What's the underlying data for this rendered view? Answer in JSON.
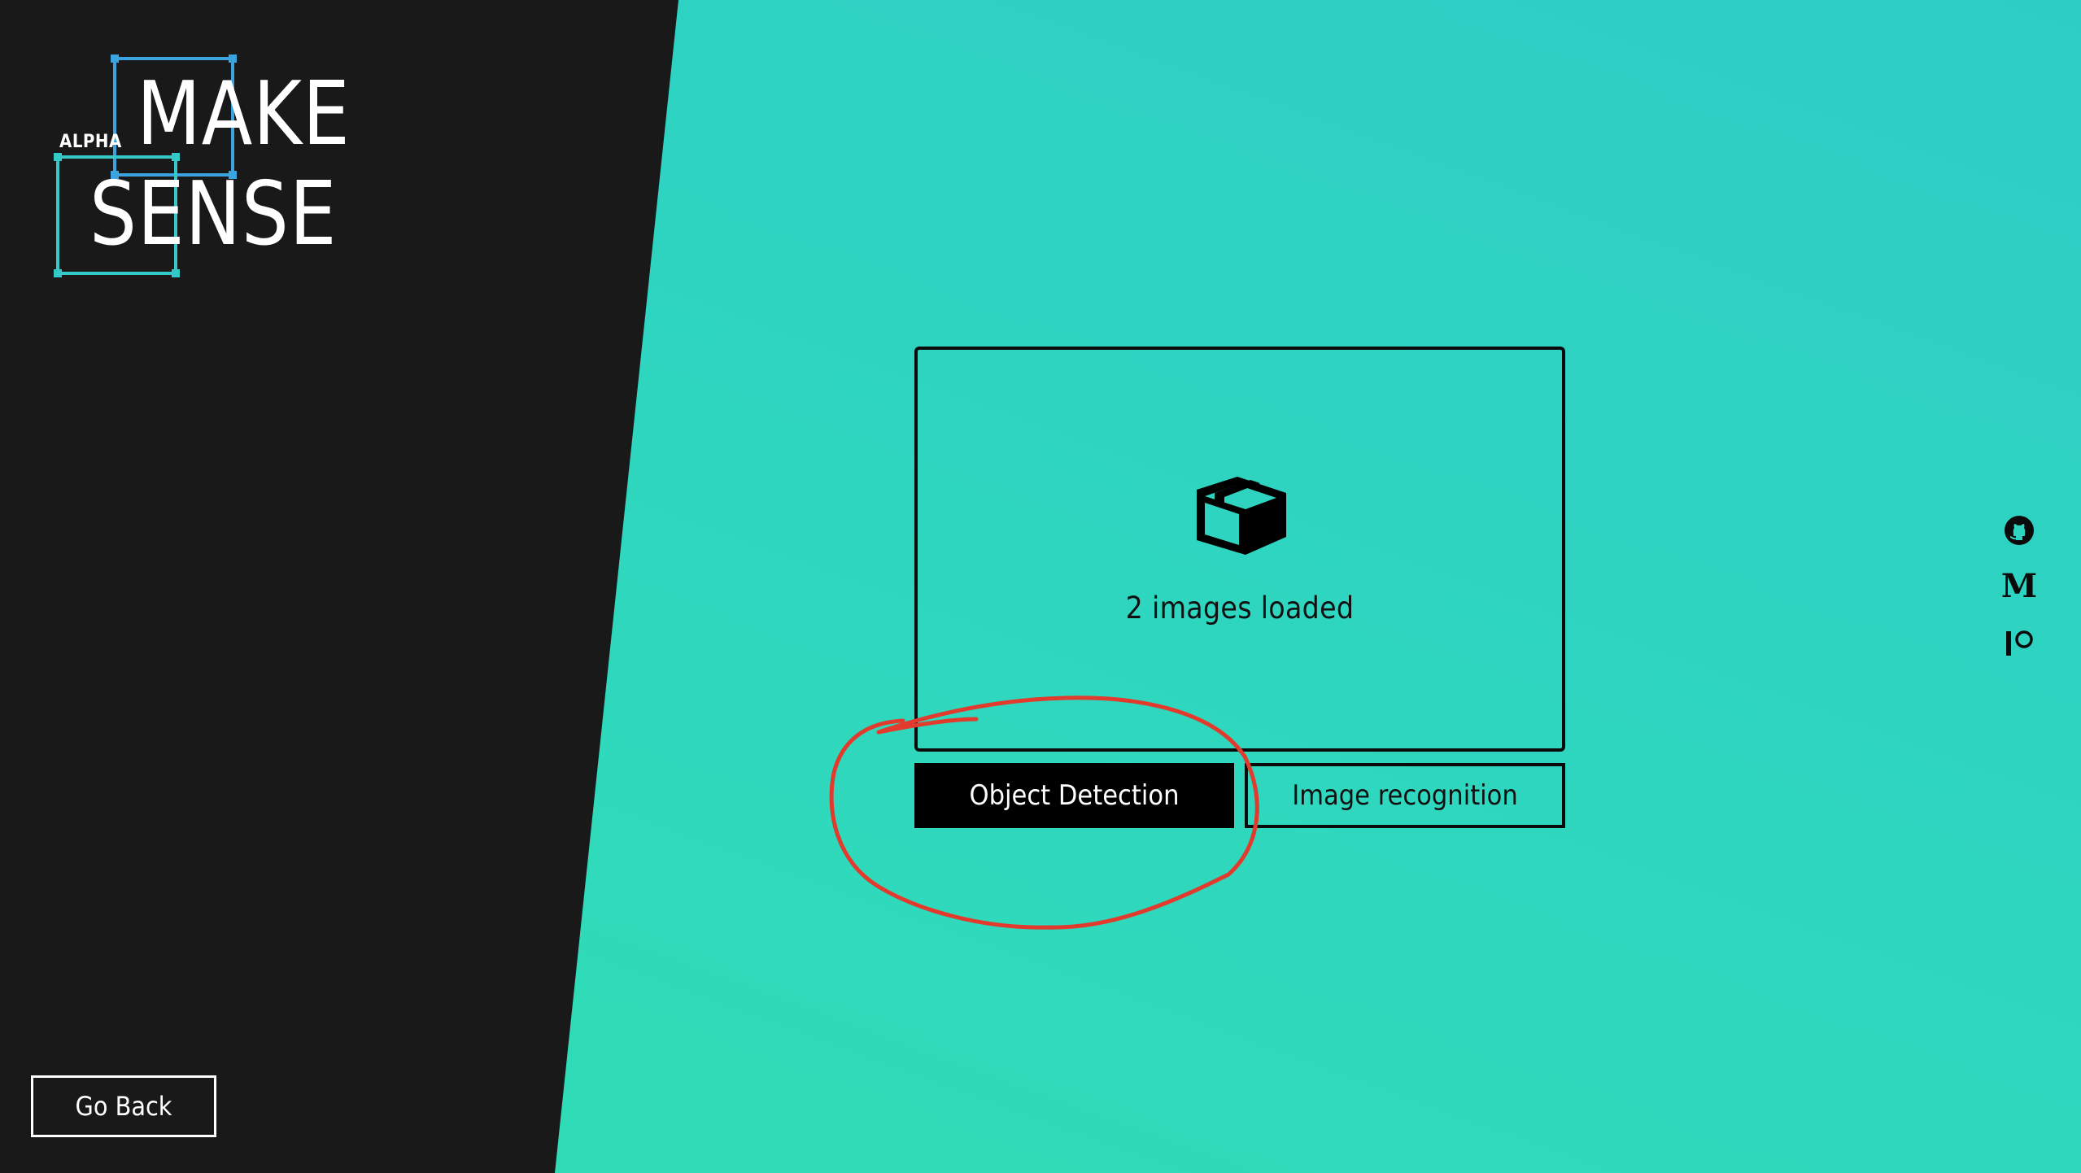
{
  "app": {
    "logo": {
      "badge": "ALPHA",
      "line1": "MAKE",
      "line2": "SENSE"
    }
  },
  "main": {
    "dropzone": {
      "icon": "box-icon",
      "status": "2 images loaded"
    },
    "buttons": {
      "object_detection": "Object Detection",
      "image_recognition": "Image recognition"
    }
  },
  "social_links": [
    {
      "icon": "github-icon"
    },
    {
      "icon": "medium-icon",
      "glyph": "M"
    },
    {
      "icon": "patreon-icon"
    }
  ],
  "footer": {
    "go_back": "Go Back"
  },
  "colors": {
    "panel": "#191919",
    "accent_gradient_top": "#2dcdc6",
    "accent_gradient_bottom": "#30deb4",
    "logo_frame_blue": "#3aa3e0",
    "logo_frame_teal": "#35c8c8",
    "annotation_red": "#e23a2c"
  }
}
